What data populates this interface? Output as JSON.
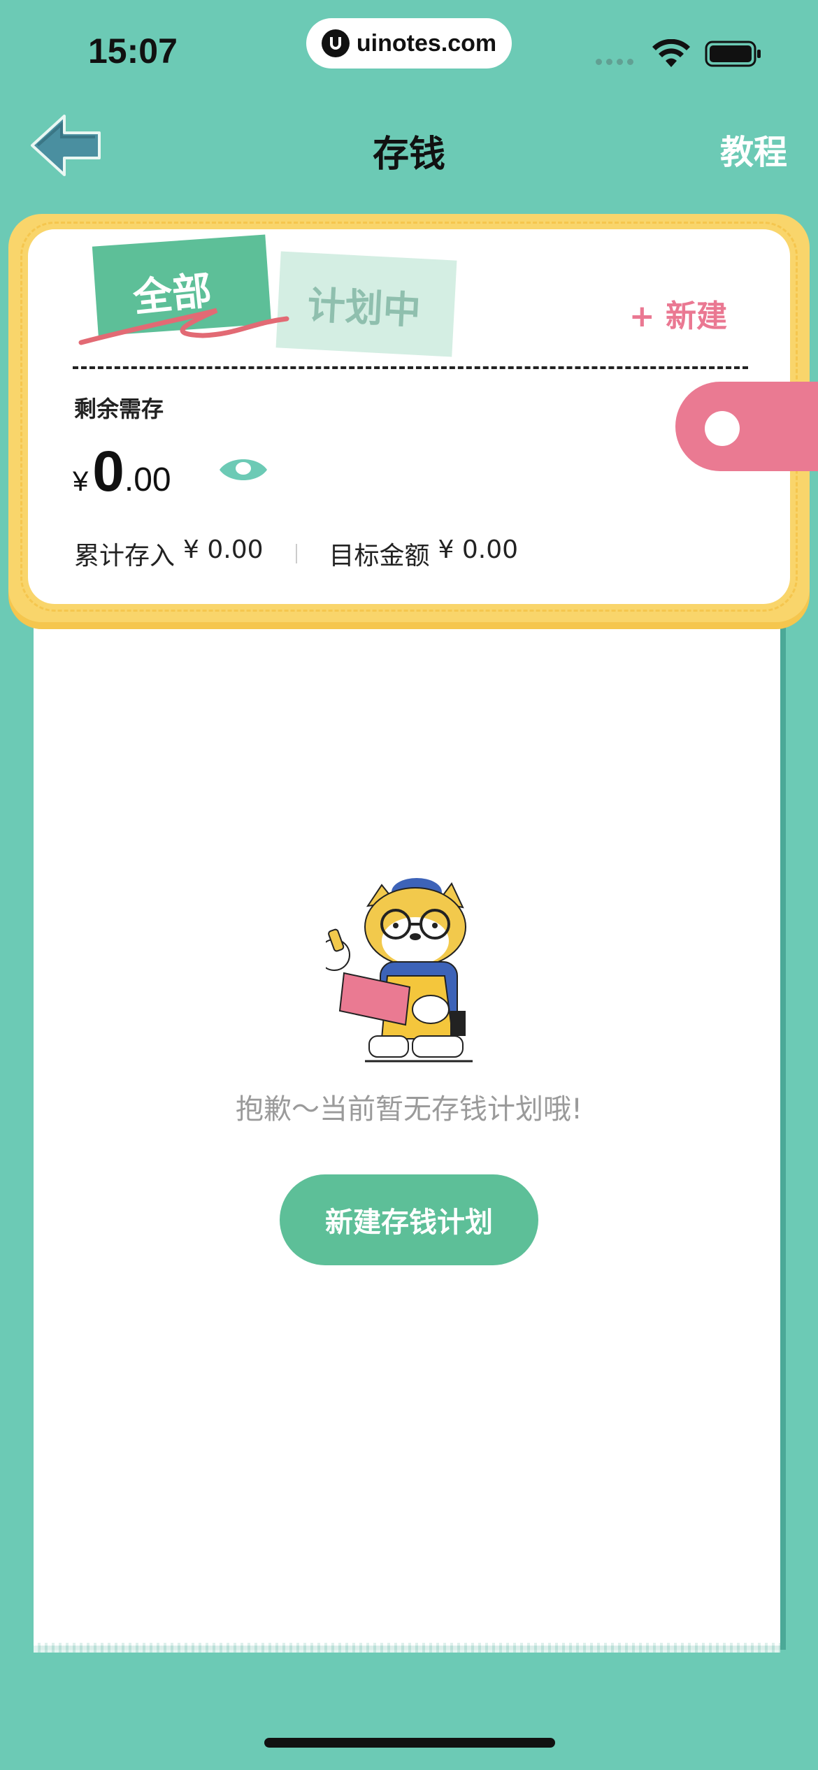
{
  "status_bar": {
    "time": "15:07",
    "url": "uinotes.com"
  },
  "nav": {
    "title": "存钱",
    "tutorial": "教程"
  },
  "card": {
    "tabs": [
      {
        "label": "全部",
        "active": true
      },
      {
        "label": "计划中",
        "active": false
      }
    ],
    "new_label": "+ 新建",
    "remaining_label": "剩余需存",
    "amount_currency": "¥",
    "amount_integer": "0",
    "amount_decimal": ".00",
    "saved_label": "累计存入",
    "saved_value": "¥ 0.00",
    "target_label": "目标金额",
    "target_value": "¥ 0.00"
  },
  "empty_state": {
    "message": "抱歉～当前暂无存钱计划哦!",
    "button_label": "新建存钱计划"
  },
  "colors": {
    "background": "#6ccab5",
    "accent_green": "#5dbf98",
    "card_yellow": "#f9d56b",
    "pink": "#ea7a92"
  }
}
